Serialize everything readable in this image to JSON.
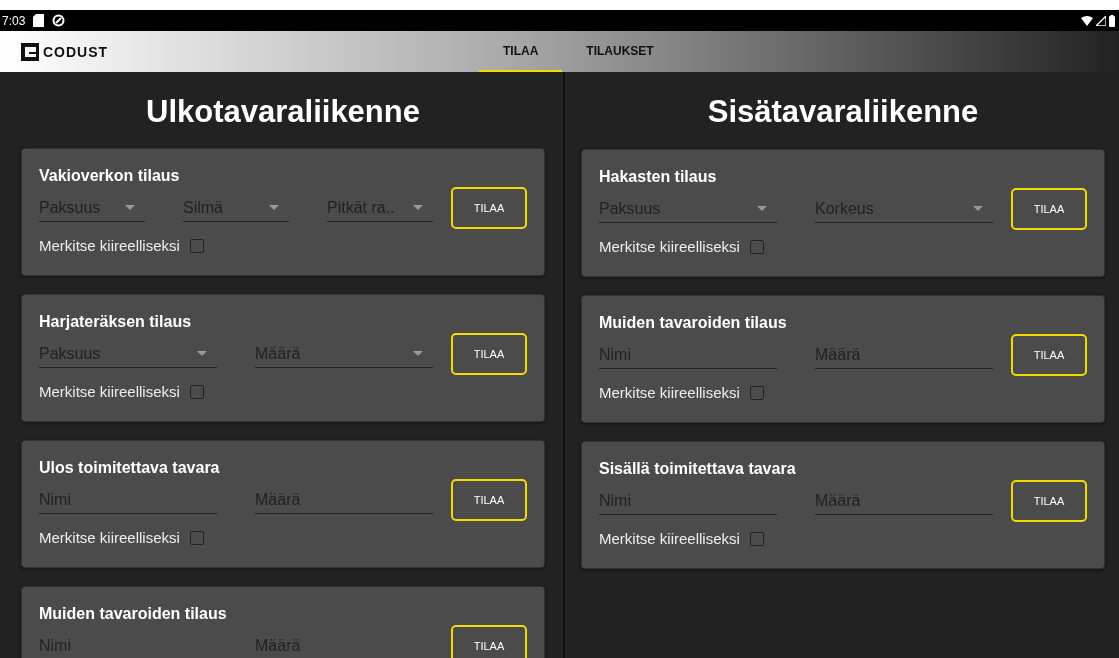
{
  "status_bar": {
    "time": "7:03"
  },
  "app_bar": {
    "logo": "CODUST",
    "tabs": [
      {
        "label": "TILAA",
        "selected": true
      },
      {
        "label": "TILAUKSET",
        "selected": false
      }
    ]
  },
  "columns": [
    {
      "title": "Ulkotavaraliikenne",
      "cards": [
        {
          "title": "Vakioverkon tilaus",
          "fields": [
            {
              "kind": "select",
              "label": "Paksuus"
            },
            {
              "kind": "select",
              "label": "Silmä"
            },
            {
              "kind": "select",
              "label": "Pitkät ra.."
            }
          ],
          "button": "TILAA",
          "urgent": {
            "label": "Merkitse kiireelliseksi",
            "checked": false
          }
        },
        {
          "title": "Harjateräksen tilaus",
          "fields": [
            {
              "kind": "select",
              "label": "Paksuus"
            },
            {
              "kind": "select",
              "label": "Määrä"
            }
          ],
          "button": "TILAA",
          "urgent": {
            "label": "Merkitse kiireelliseksi",
            "checked": false
          }
        },
        {
          "title": "Ulos toimitettava tavara",
          "fields": [
            {
              "kind": "input",
              "placeholder": "Nimi"
            },
            {
              "kind": "input",
              "placeholder": "Määrä"
            }
          ],
          "button": "TILAA",
          "urgent": {
            "label": "Merkitse kiireelliseksi",
            "checked": false
          }
        },
        {
          "title": "Muiden tavaroiden tilaus",
          "fields": [
            {
              "kind": "input",
              "placeholder": "Nimi"
            },
            {
              "kind": "input",
              "placeholder": "Määrä"
            }
          ],
          "button": "TILAA"
        }
      ]
    },
    {
      "title": "Sisätavaraliikenne",
      "cards": [
        {
          "title": "Hakasten tilaus",
          "fields": [
            {
              "kind": "select",
              "label": "Paksuus"
            },
            {
              "kind": "select",
              "label": "Korkeus"
            }
          ],
          "button": "TILAA",
          "urgent": {
            "label": "Merkitse kiireelliseksi",
            "checked": false
          }
        },
        {
          "title": "Muiden tavaroiden tilaus",
          "fields": [
            {
              "kind": "input",
              "placeholder": "Nimi"
            },
            {
              "kind": "input",
              "placeholder": "Määrä"
            }
          ],
          "button": "TILAA",
          "urgent": {
            "label": "Merkitse kiireelliseksi",
            "checked": false
          }
        },
        {
          "title": "Sisällä toimitettava tavara",
          "fields": [
            {
              "kind": "input",
              "placeholder": "Nimi"
            },
            {
              "kind": "input",
              "placeholder": "Määrä"
            }
          ],
          "button": "TILAA",
          "urgent": {
            "label": "Merkitse kiireelliseksi",
            "checked": false
          }
        }
      ]
    }
  ]
}
